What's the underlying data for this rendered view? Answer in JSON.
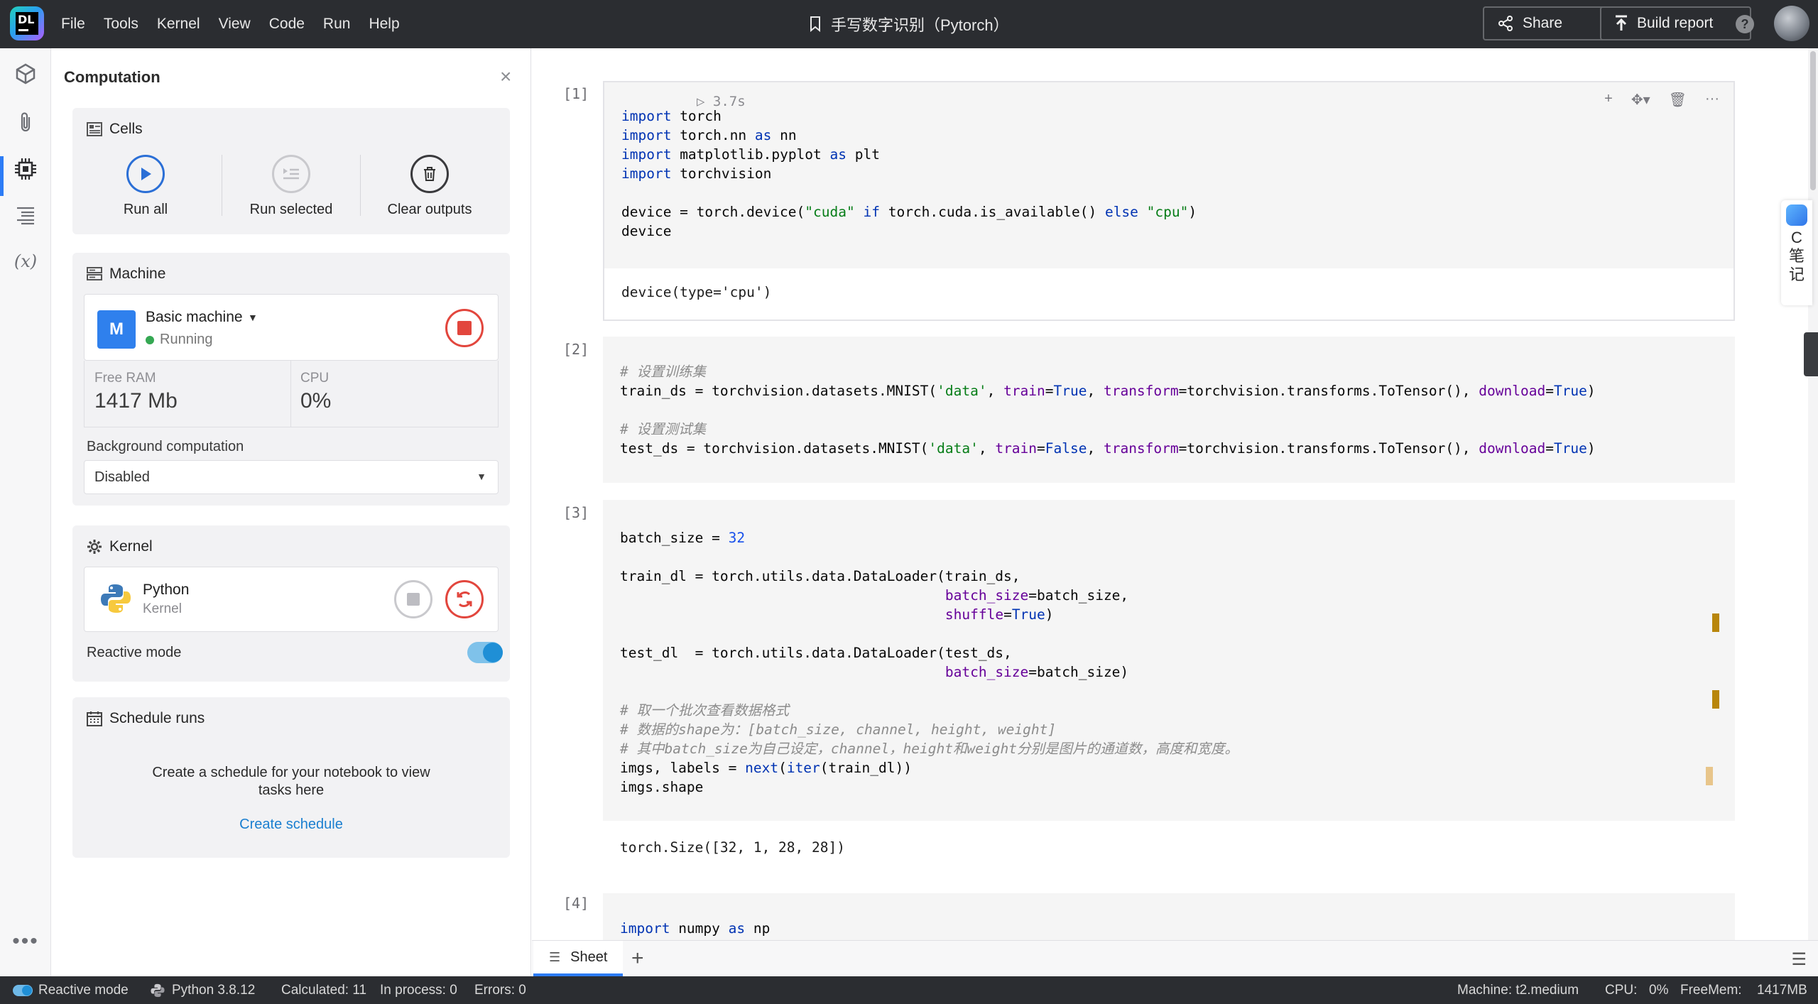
{
  "app": {
    "logo_text": "DL",
    "menus": [
      "File",
      "Tools",
      "Kernel",
      "View",
      "Code",
      "Run",
      "Help"
    ],
    "doc_title": "手写数字识别（Pytorch）",
    "share_label": "Share",
    "build_report_label": "Build report"
  },
  "panel": {
    "title": "Computation",
    "cells": {
      "heading": "Cells",
      "run_all": "Run all",
      "run_selected": "Run selected",
      "clear_outputs": "Clear outputs"
    },
    "machine": {
      "heading": "Machine",
      "badge": "M",
      "name": "Basic machine",
      "status": "Running",
      "free_ram_label": "Free RAM",
      "free_ram_value": "1417 Mb",
      "cpu_label": "CPU",
      "cpu_value": "0%",
      "bg_label": "Background computation",
      "bg_value": "Disabled"
    },
    "kernel": {
      "heading": "Kernel",
      "name": "Python",
      "sub": "Kernel",
      "reactive_label": "Reactive mode",
      "reactive_on": true
    },
    "schedule": {
      "heading": "Schedule runs",
      "text": "Create a schedule for your notebook to view tasks here",
      "link": "Create schedule"
    }
  },
  "notebook": {
    "cells": [
      {
        "num": "[1]",
        "time": "3.7s",
        "output": "device(type='cpu')"
      },
      {
        "num": "[2]"
      },
      {
        "num": "[3]",
        "output": "torch.Size([32, 1, 28, 28])"
      },
      {
        "num": "[4]"
      }
    ]
  },
  "side_widget": {
    "line1": "C",
    "line2": "笔",
    "line3": "记"
  },
  "tabs": {
    "sheet": "Sheet"
  },
  "status": {
    "reactive": "Reactive mode",
    "python": "Python 3.8.12",
    "calculated": "Calculated: 11",
    "in_process": "In process: 0",
    "errors": "Errors: 0",
    "machine": "Machine: t2.medium",
    "cpu_label": "CPU:",
    "cpu_value": "0%",
    "freemem": "FreeMem:",
    "freemem_value": "1417MB"
  },
  "colors": {
    "accent": "#2d7cf6",
    "danger": "#e2463d",
    "running": "#35a853"
  }
}
